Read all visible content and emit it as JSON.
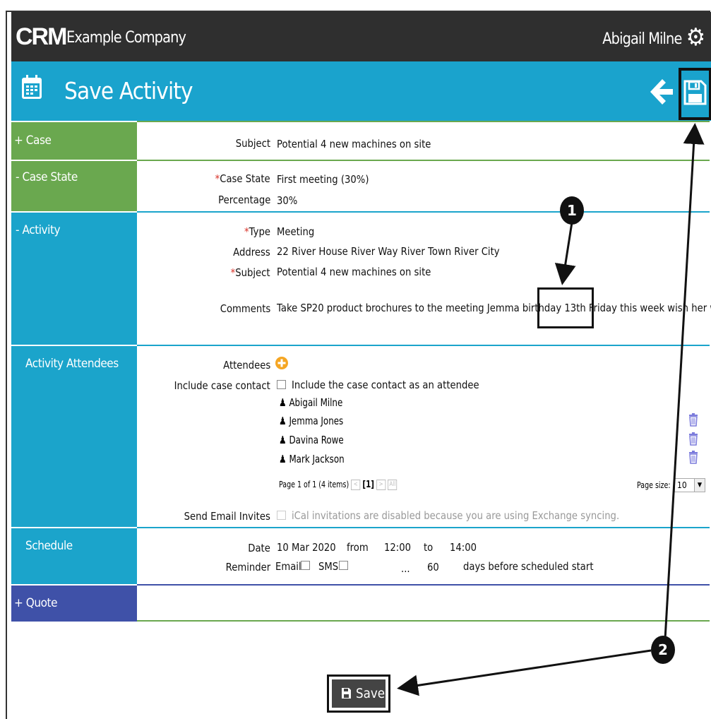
{
  "header": {
    "logo": "CRM",
    "company": "Example Company",
    "user": "Abigail Milne"
  },
  "title": "Save Activity",
  "sections": {
    "case": "+ Case",
    "case_state": "- Case State",
    "activity": "- Activity",
    "attendees": "Activity Attendees",
    "schedule": "Schedule",
    "quote": "+ Quote"
  },
  "case": {
    "subject_label": "Subject",
    "subject_value": "Potential 4 new machines on site"
  },
  "case_state": {
    "state_label": "Case State",
    "state_value": "First meeting (30%)",
    "percentage_label": "Percentage",
    "percentage_value": "30%"
  },
  "activity": {
    "type_label": "Type",
    "type_value": "Meeting",
    "address_label": "Address",
    "address_value": "22 River House River Way River Town River City",
    "subject_label": "Subject",
    "subject_value": "Potential 4 new machines on site",
    "comments_label": "Comments",
    "comments_pre": "Take SP20 product brochures to the meeting Jemma birthday",
    "comments_highlight": "13th Friday",
    "comments_post": "this week wish her well"
  },
  "attendees": {
    "attendees_label": "Attendees",
    "include_label": "Include case contact",
    "include_text": "Include the case contact as an attendee",
    "people": [
      "Abigail Milne",
      "Jemma Jones",
      "Davina Rowe",
      "Mark Jackson"
    ],
    "pager_text": "Page 1 of 1 (4 items)",
    "pager_current": "[1]",
    "page_size_label": "Page size:",
    "page_size_value": "10",
    "send_label": "Send Email Invites",
    "send_text": "iCal invitations are disabled because you are using Exchange syncing."
  },
  "schedule": {
    "date_label": "Date",
    "date_value": "10 Mar 2020",
    "from_label": "from",
    "from_value": "12:00",
    "to_label": "to",
    "to_value": "14:00",
    "reminder_label": "Reminder",
    "email_label": "Email",
    "sms_label": "SMS",
    "ellipsis": "...",
    "days_value": "60",
    "days_text": "days before scheduled start"
  },
  "save_button": "Save",
  "callouts": [
    "1",
    "2"
  ]
}
